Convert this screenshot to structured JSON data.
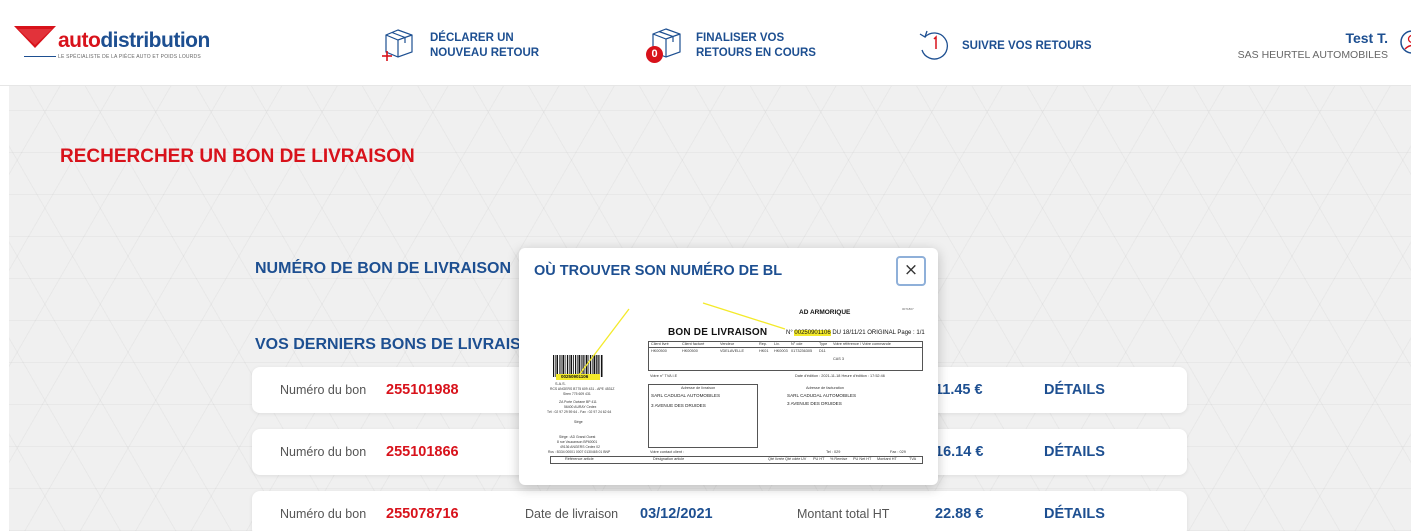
{
  "brand": {
    "name_part1": "auto",
    "name_part2": "distribution",
    "tagline": "LE SPÉCIALISTE DE LA PIÈCE AUTO ET POIDS LOURDS",
    "color_red": "#d8121b",
    "color_blue": "#1d4f91"
  },
  "nav": {
    "declare": {
      "line1": "DÉCLARER UN",
      "line2": "NOUVEAU RETOUR",
      "icon": "box-plus-icon"
    },
    "finalise": {
      "line1": "FINALISER VOS",
      "line2": "RETOURS EN COURS",
      "badge": "0",
      "icon": "box-icon"
    },
    "follow": {
      "label": "SUIVRE VOS RETOURS",
      "icon": "history-icon"
    }
  },
  "user": {
    "name": "Test T.",
    "company": "SAS HEURTEL AUTOMOBILES",
    "icon": "user-icon"
  },
  "page": {
    "title": "RECHERCHER UN BON DE LIVRAISON",
    "section_number": "NUMÉRO DE BON DE LIVRAISON",
    "section_last": "VOS DERNIERS BONS DE LIVRAISON"
  },
  "rows": [
    {
      "number_label": "Numéro du bon",
      "number": "255101988",
      "date_label": "",
      "date": "",
      "amount_label": "",
      "amount": "11.45 €",
      "details": "DÉTAILS"
    },
    {
      "number_label": "Numéro du bon",
      "number": "255101866",
      "date_label": "",
      "date": "",
      "amount_label": "",
      "amount": "16.14 €",
      "details": "DÉTAILS"
    },
    {
      "number_label": "Numéro du bon",
      "number": "255078716",
      "date_label": "Date de livraison",
      "date": "03/12/2021",
      "amount_label": "Montant total HT",
      "amount": "22.88 €",
      "details": "DÉTAILS"
    }
  ],
  "modal": {
    "title": "OÙ TROUVER SON NUMÉRO DE BL",
    "close": "×",
    "doc": {
      "company": "AD ARMORIQUE",
      "ref_code": "0071807",
      "heading": "BON DE LIVRAISON",
      "number_prefix": "N°",
      "number": "00250901106",
      "number_suffix": " DU 18/11/21  ORIGINAL  Page : 1/1",
      "table_headers": [
        "Client livré",
        "Client facturé",
        "Vendeur",
        "Rep.",
        "Liv.",
        "N° cde",
        "Type",
        "Votre référence / Votre commande"
      ],
      "table_values": [
        "HK00500",
        "HK00500",
        "VDELAVELLE",
        "HK01",
        "HK0003",
        "0173236305",
        "D11"
      ],
      "extra": "CAS 3",
      "vat_label": "Votre n° TVA I.E",
      "edit_date": "Date d'édition : 2021-11-18    Heure d'édition : 17:52:46",
      "delivery_label": "Adresse de livraison",
      "billing_label": "Adresse de facturation",
      "delivery_name": "SARL CADUDAL AUTOMOBILES",
      "delivery_street": "3 AVENUE DES DRUIDES",
      "billing_name": "SARL CADUDAL AUTOMOBILES",
      "billing_street": "3 AVENUE DES DRUIDES",
      "contact_label": "Votre contact client :",
      "tel": "Tel : 029",
      "fax": "Fax : 029",
      "barcode_number": "00250901106",
      "left_info": [
        "S.A.S.",
        "RCS ANGERS B775 609 431 - APE 4531Z",
        "Siren 775 609 431",
        "ZA Porte Océane BP 411",
        "56400 AURAY Cedex",
        "Tél : 02 97 29 59 64 - Fax : 02 97 24 62 64",
        "Siège",
        "Siège : AD Grand Ouest",
        "8 rue Vaucanson BP60001",
        "49136 ANGERS Cedex 02",
        "Rcs : B334 00001 0007 0130465 01 BNP"
      ],
      "footer_cols": [
        "Référence article",
        "Désignation article",
        "Qté livrée",
        "Qté cdée",
        "UV",
        "PU HT",
        "% Remise",
        "PU Net HT",
        "Montant HT",
        "TVA"
      ]
    }
  }
}
